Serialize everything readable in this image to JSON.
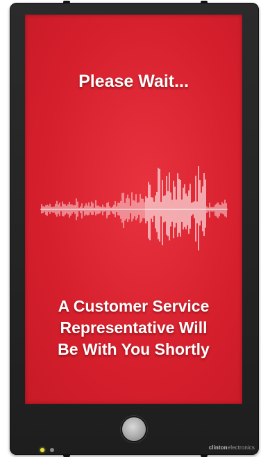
{
  "screen": {
    "headline": "Please Wait...",
    "message_lines": [
      "A Customer Service",
      "Representative Will",
      "Be With You Shortly"
    ]
  },
  "device": {
    "brand_bold": "clinton",
    "brand_light": "electronics",
    "indicator_colors": [
      "#e7e23a",
      "#8a8a8a"
    ]
  },
  "icons": {
    "waveform": "audio-waveform-icon",
    "call_button": "call-button-icon"
  },
  "colors": {
    "screen_red": "#d61f2d",
    "bezel": "#232323",
    "text": "#ffffff"
  }
}
